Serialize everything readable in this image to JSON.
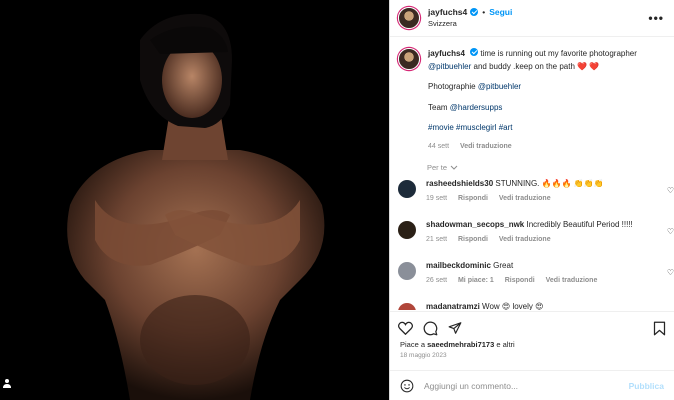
{
  "post": {
    "username": "jayfuchs4",
    "follow_label": "Segui",
    "location": "Svizzera",
    "more_label": "•••"
  },
  "caption": {
    "username": "jayfuchs4",
    "line1": "time is running out my favorite photographer",
    "mention1": "@pitbuehler",
    "line1_tail": "and buddy .keep on the path ❤️ ❤️",
    "photo_label": "Photographie",
    "photo_mention": "@pitbuehler",
    "team_label": "Team",
    "team_mention": "@hardersupps",
    "hashtags": "#movie #musclegirl #art",
    "time": "44 sett",
    "translate": "Vedi traduzione"
  },
  "per_te": "Per te",
  "comments": [
    {
      "user": "rasheedshields30",
      "text": "STUNNING. 🔥🔥🔥 👏👏👏",
      "time": "19 sett",
      "reply": "Rispondi",
      "likes": "",
      "translate": "Vedi traduzione",
      "avatar_color": "#1d2b3a"
    },
    {
      "user": "shadowman_secops_nwk",
      "text": "Incredibly Beautiful Period !!!!!",
      "time": "21 sett",
      "reply": "Rispondi",
      "likes": "",
      "translate": "Vedi traduzione",
      "avatar_color": "#2a2016"
    },
    {
      "user": "mailbeckdominic",
      "text": "Great",
      "time": "26 sett",
      "reply": "Rispondi",
      "likes": "Mi piace: 1",
      "translate": "Vedi traduzione",
      "avatar_color": "#8a8f99"
    },
    {
      "user": "madanatramzi",
      "text": "Wow 😍 lovely 😍",
      "time": "",
      "reply": "",
      "likes": "",
      "translate": "",
      "avatar_color": "#b0463a"
    }
  ],
  "actions": {
    "likes_prefix": "Piace a",
    "likes_user": "saeedmehrabi7173",
    "likes_suffix": "e altri",
    "date": "18 maggio 2023"
  },
  "composer": {
    "placeholder": "Aggiungi un commento...",
    "publish_label": "Pubblica"
  },
  "icons": [
    "heart-icon",
    "comment-icon",
    "share-icon",
    "bookmark-icon",
    "emoji-icon",
    "tag-user-icon",
    "more-icon",
    "verified-icon",
    "chevron-down-icon"
  ],
  "colors": {
    "accent": "#0095f6",
    "link": "#00376b",
    "muted": "#8e8e8e"
  }
}
